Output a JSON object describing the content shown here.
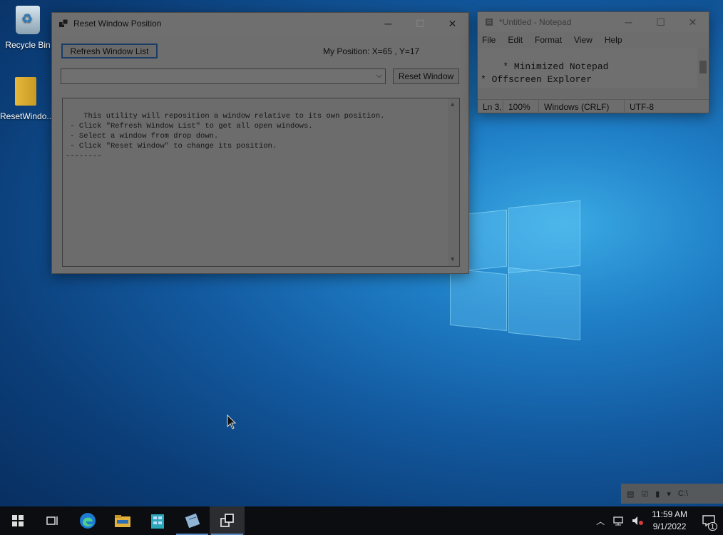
{
  "desktop": {
    "icons": [
      {
        "label": "Recycle Bin",
        "icon": "recycle-bin-icon"
      },
      {
        "label": "ResetWindo...",
        "icon": "folder-icon"
      }
    ]
  },
  "reset_window": {
    "title": "Reset Window Position",
    "refresh_label": "Refresh Window List",
    "position_text": "My Position:  X=65 , Y=17",
    "select_value": "",
    "reset_label": "Reset Window",
    "log_text": "This utility will reposition a window relative to its own position.\n - Click \"Refresh Window List\" to get all open windows.\n - Select a window from drop down.\n - Click \"Reset Window\" to change its position.\n--------",
    "controls": {
      "minimize": "─",
      "maximize": "☐",
      "close": "✕"
    }
  },
  "notepad": {
    "title": "*Untitled - Notepad",
    "menu": [
      "File",
      "Edit",
      "Format",
      "View",
      "Help"
    ],
    "content": "* Minimized Notepad\n* Offscreen Explorer",
    "status": {
      "position": "Ln 3,",
      "zoom": "100%",
      "line_ending": "Windows (CRLF)",
      "encoding": "UTF-8"
    },
    "controls": {
      "minimize": "─",
      "maximize": "☐",
      "close": "✕"
    }
  },
  "taskbar": {
    "items": [
      "start-icon",
      "task-view-icon",
      "edge-icon",
      "file-explorer-icon",
      "server-manager-icon",
      "notepad-icon",
      "reset-window-app-icon"
    ],
    "tray_toolbar_text": "C:\\",
    "time": "11:59 AM",
    "date": "9/1/2022",
    "notification_count": "1"
  },
  "colors": {
    "accent": "#1a3d66",
    "taskbar": "#0b0d11"
  }
}
